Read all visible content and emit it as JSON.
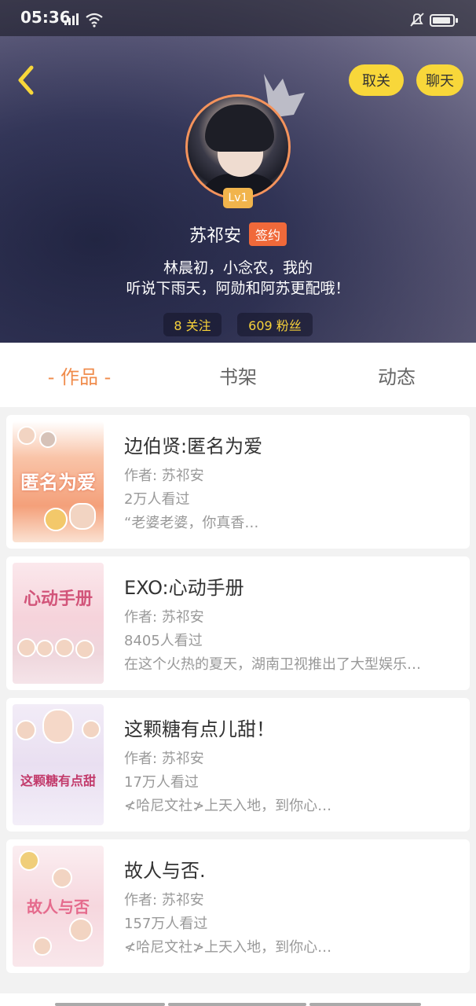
{
  "status": {
    "time": "05:36"
  },
  "header": {
    "unfollow_label": "取关",
    "chat_label": "聊天",
    "level": "Lv1",
    "name": "苏祁安",
    "sign_badge": "签约",
    "bio_line1": "林晨初，小念农，我的",
    "bio_line2": "听说下雨天，阿勋和阿苏更配哦！",
    "follow_stat": "8 关注",
    "fans_stat": "609 粉丝"
  },
  "tabs": [
    {
      "label": "- 作品 -",
      "active": true
    },
    {
      "label": "书架",
      "active": false
    },
    {
      "label": "动态",
      "active": false
    }
  ],
  "books": [
    {
      "title": "边伯贤:匿名为爱",
      "author": "作者: 苏祁安",
      "views": "2万人看过",
      "snippet": "“老婆老婆，你真香…"
    },
    {
      "title": "EXO:心动手册",
      "author": "作者: 苏祁安",
      "views": "8405人看过",
      "snippet": "在这个火热的夏天，湖南卫视推出了大型娱乐…"
    },
    {
      "title": "这颗糖有点儿甜！",
      "author": "作者: 苏祁安",
      "views": "17万人看过",
      "snippet": "≮哈尼文社≯上天入地，到你心…"
    },
    {
      "title": "故人与否.",
      "author": "作者: 苏祁安",
      "views": "157万人看过",
      "snippet": "≮哈尼文社≯上天入地，到你心…"
    }
  ],
  "covers": [
    {
      "title": "匿名为爱",
      "bg": "#f6b08f",
      "fg": "#ffffff"
    },
    {
      "title": "心动手册",
      "bg": "#f7dfe4",
      "fg": "#d2557a"
    },
    {
      "title": "这颗糖有点甜",
      "bg": "#efe6f5",
      "fg": "#c23a6b"
    },
    {
      "title": "故人与否",
      "bg": "#f7e1e6",
      "fg": "#e56b8d"
    }
  ],
  "colors": {
    "accent": "#f08c4c",
    "pill": "#f8d73a",
    "badge": "#f0693a",
    "stat_text": "#f7d23a"
  }
}
